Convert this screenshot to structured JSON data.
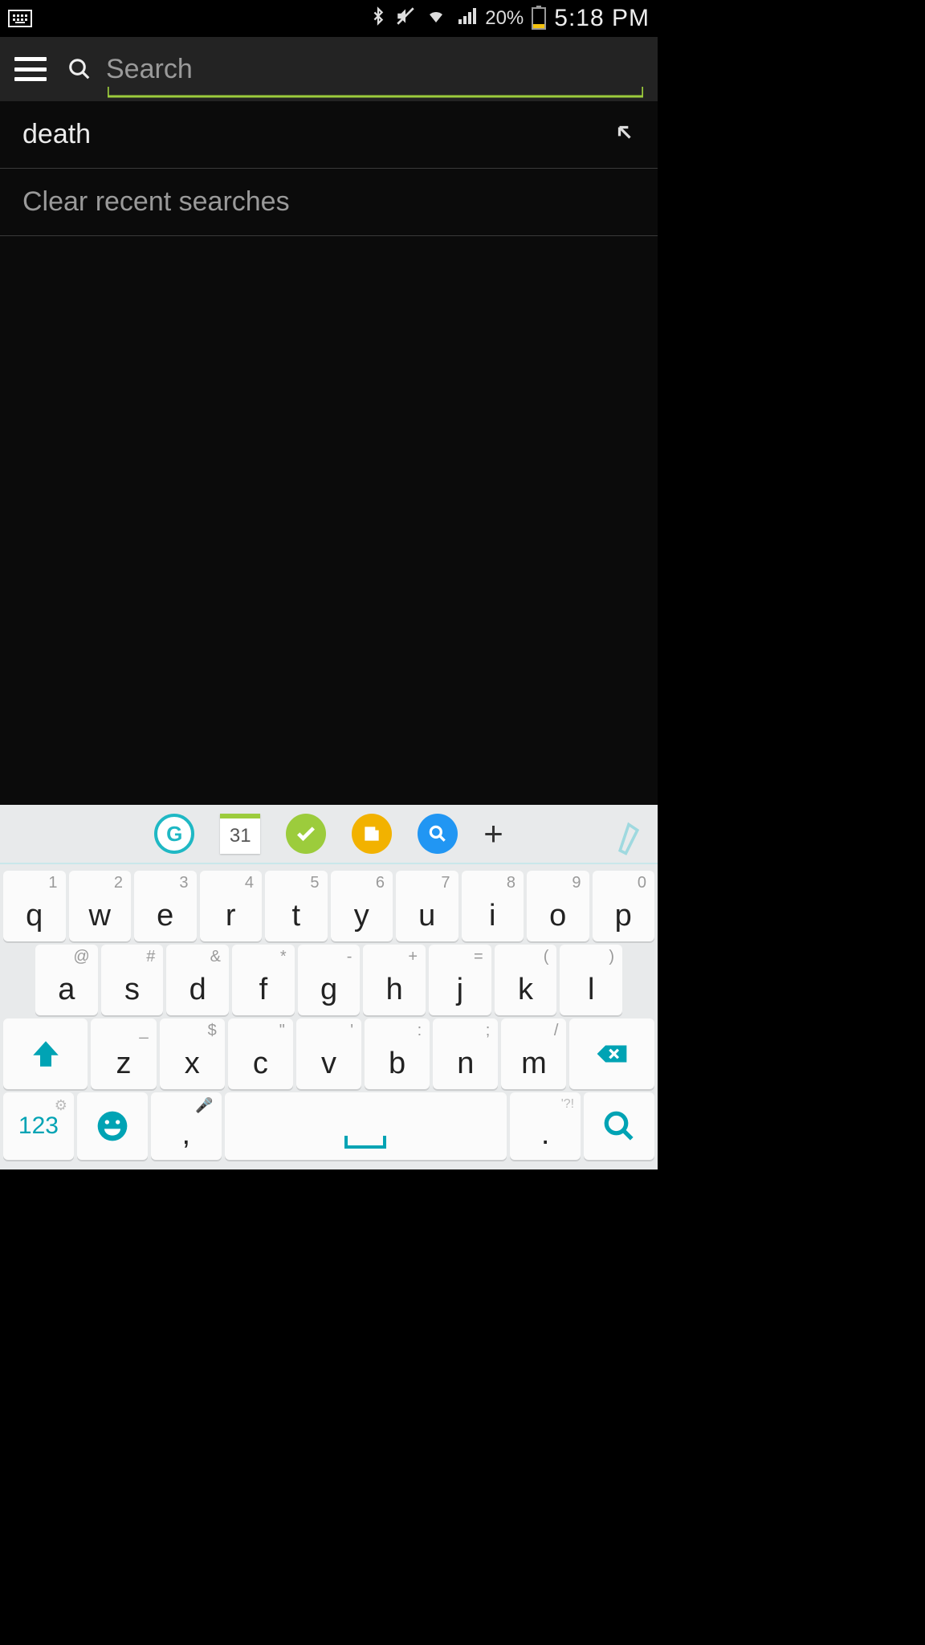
{
  "status": {
    "battery_pct": "20%",
    "time": "5:18 PM"
  },
  "header": {
    "search_placeholder": "Search",
    "search_value": ""
  },
  "suggestions": {
    "items": [
      {
        "text": "death"
      }
    ],
    "clear_label": "Clear recent searches"
  },
  "keyboard": {
    "suggest_cal": "31",
    "row1": [
      {
        "k": "q",
        "a": "1"
      },
      {
        "k": "w",
        "a": "2"
      },
      {
        "k": "e",
        "a": "3"
      },
      {
        "k": "r",
        "a": "4"
      },
      {
        "k": "t",
        "a": "5"
      },
      {
        "k": "y",
        "a": "6"
      },
      {
        "k": "u",
        "a": "7"
      },
      {
        "k": "i",
        "a": "8"
      },
      {
        "k": "o",
        "a": "9"
      },
      {
        "k": "p",
        "a": "0"
      }
    ],
    "row2": [
      {
        "k": "a",
        "a": "@"
      },
      {
        "k": "s",
        "a": "#"
      },
      {
        "k": "d",
        "a": "&"
      },
      {
        "k": "f",
        "a": "*"
      },
      {
        "k": "g",
        "a": "-"
      },
      {
        "k": "h",
        "a": "+"
      },
      {
        "k": "j",
        "a": "="
      },
      {
        "k": "k",
        "a": "("
      },
      {
        "k": "l",
        "a": ")"
      }
    ],
    "row3": [
      {
        "k": "z",
        "a": "_"
      },
      {
        "k": "x",
        "a": "$"
      },
      {
        "k": "c",
        "a": "\""
      },
      {
        "k": "v",
        "a": "'"
      },
      {
        "k": "b",
        "a": ":"
      },
      {
        "k": "n",
        "a": ";"
      },
      {
        "k": "m",
        "a": "/"
      }
    ],
    "num_label": "123",
    "comma": ",",
    "period": ".",
    "period_alt": "'?!"
  }
}
